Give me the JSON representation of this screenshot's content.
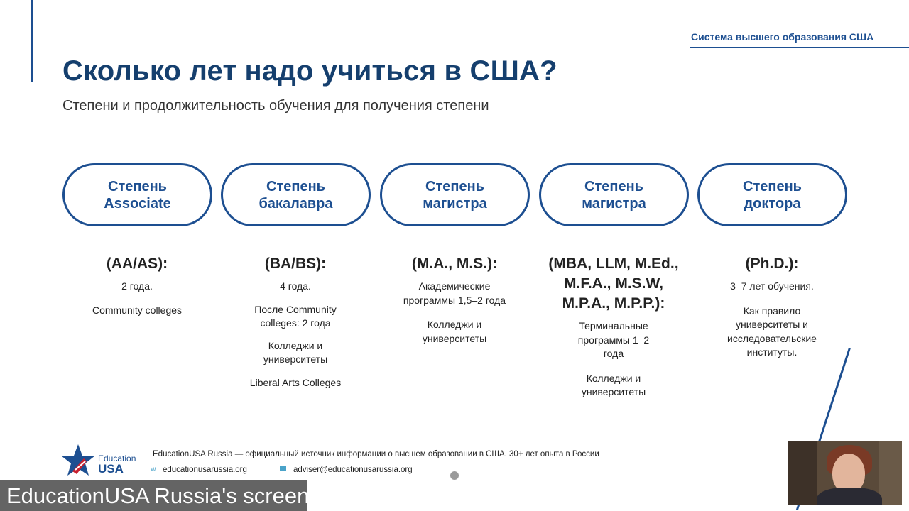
{
  "header_tag": "Система высшего образования США",
  "title": "Сколько лет надо учиться в США?",
  "subtitle": "Степени и продолжительность обучения для получения степени",
  "degrees": [
    {
      "pill": [
        "Степень",
        "Associate"
      ],
      "code": [
        "(AA/AS):"
      ],
      "details": [
        "2 года.",
        "Community colleges"
      ]
    },
    {
      "pill": [
        "Степень",
        "бакалавра"
      ],
      "code": [
        "(BA/BS):"
      ],
      "details": [
        "4 года.",
        "После Community colleges: 2 года",
        "Колледжи и университеты",
        "Liberal Arts Colleges"
      ]
    },
    {
      "pill": [
        "Степень",
        "магистра"
      ],
      "code": [
        "(M.A., M.S.):"
      ],
      "details": [
        "Академические программы 1,5–2 года",
        "Колледжи и университеты"
      ]
    },
    {
      "pill": [
        "Степень",
        "магистра"
      ],
      "code": [
        "(MBA, LLM, M.Ed.,",
        "M.F.A., M.S.W,",
        "M.P.A., M.P.P.):"
      ],
      "details": [
        "Терминальные программы 1–2 года",
        "Колледжи и университеты"
      ]
    },
    {
      "pill": [
        "Степень",
        "доктора"
      ],
      "code": [
        "(Ph.D.):"
      ],
      "details": [
        "3–7 лет обучения.",
        "Как правило университеты и исследовательские институты."
      ]
    }
  ],
  "footer": {
    "logo_top": "Education",
    "logo_bottom": "USA",
    "tagline": "EducationUSA Russia — официальный источник информации о высшем образовании в США. 30+ лет опыта в России",
    "website": "educationusarussia.org",
    "email": "adviser@educationusarussia.org"
  },
  "screen_label": "EducationUSA Russia's screen",
  "colors": {
    "brand_blue": "#1d4f91",
    "title_blue": "#153f6e",
    "accent_red": "#c8202f"
  }
}
